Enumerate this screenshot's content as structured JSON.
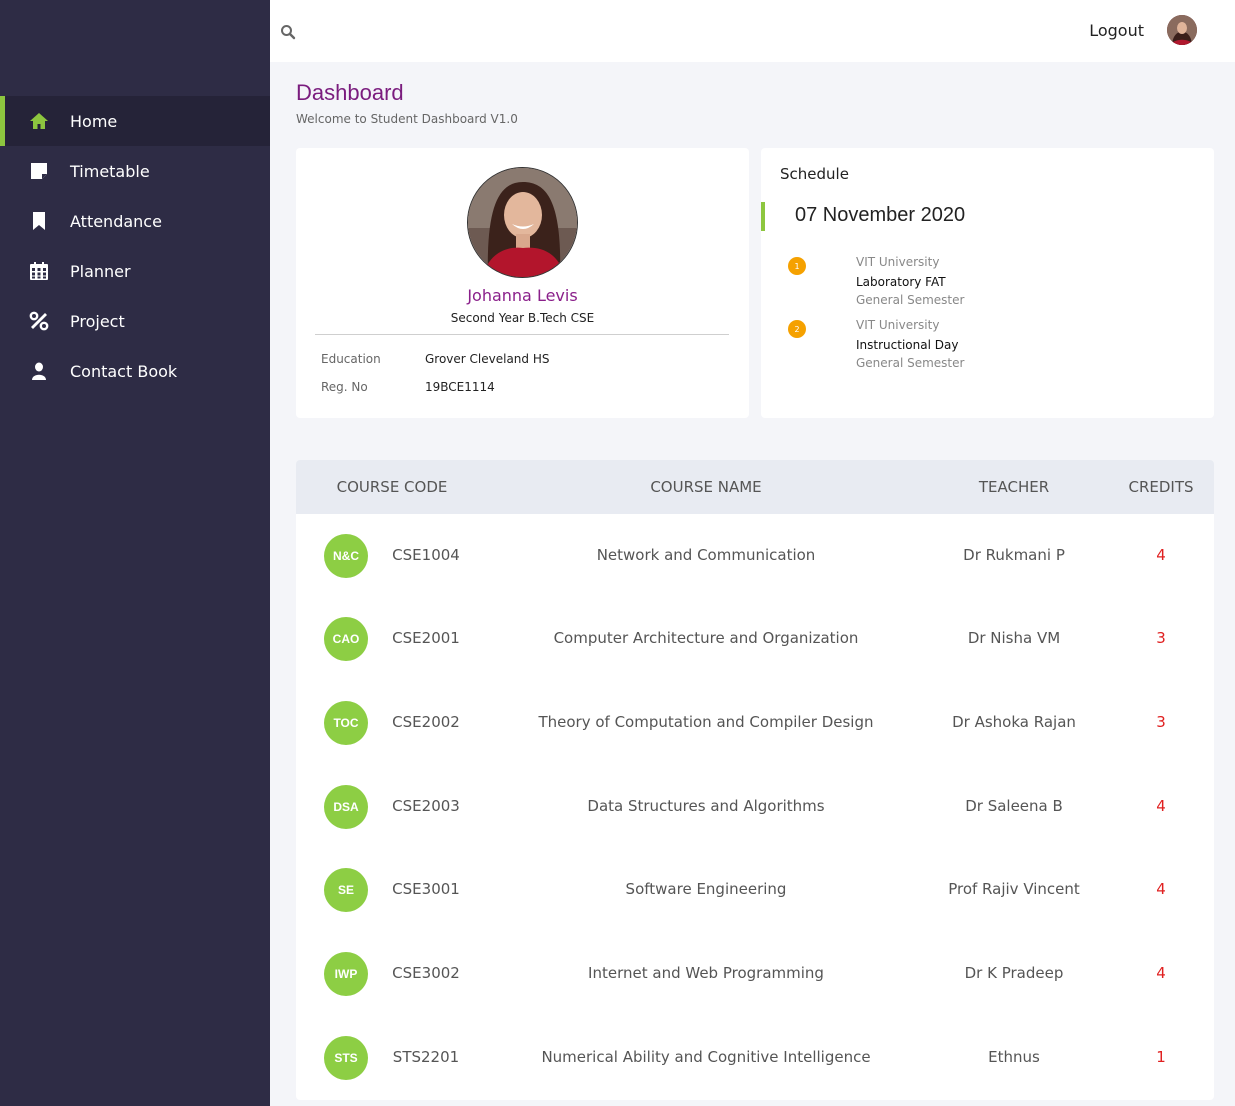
{
  "sidebar": {
    "items": [
      {
        "label": "Home",
        "icon": "home-icon",
        "active": true
      },
      {
        "label": "Timetable",
        "icon": "note-icon",
        "active": false
      },
      {
        "label": "Attendance",
        "icon": "bookmark-icon",
        "active": false
      },
      {
        "label": "Planner",
        "icon": "calendar-icon",
        "active": false
      },
      {
        "label": "Project",
        "icon": "percent-icon",
        "active": false
      },
      {
        "label": "Contact Book",
        "icon": "user-icon",
        "active": false
      }
    ],
    "accent": "#8dc63f",
    "background": "#2e2c45"
  },
  "topbar": {
    "logout_label": "Logout"
  },
  "header": {
    "title": "Dashboard",
    "subtitle": "Welcome to Student Dashboard V1.0"
  },
  "profile": {
    "name": "Johanna Levis",
    "year": "Second Year B.Tech CSE",
    "education_label": "Education",
    "education_value": "Grover Cleveland HS",
    "reg_label": "Reg. No",
    "reg_value": "19BCE1114"
  },
  "schedule": {
    "title": "Schedule",
    "date": "07 November 2020",
    "events": [
      {
        "num": "1",
        "org": "VIT University",
        "event": "Laboratory FAT",
        "term": "General Semester"
      },
      {
        "num": "2",
        "org": "VIT University",
        "event": "Instructional Day",
        "term": "General Semester"
      }
    ],
    "dot_color": "#f5a100"
  },
  "courses": {
    "headers": {
      "code": "COURSE CODE",
      "name": "COURSE NAME",
      "teacher": "TEACHER",
      "credits": "CREDITS"
    },
    "rows": [
      {
        "abbr": "N&C",
        "code": "CSE1004",
        "name": "Network and Communication",
        "teacher": "Dr Rukmani P",
        "credits": "4"
      },
      {
        "abbr": "CAO",
        "code": "CSE2001",
        "name": "Computer Architecture and Organization",
        "teacher": "Dr Nisha VM",
        "credits": "3"
      },
      {
        "abbr": "TOC",
        "code": "CSE2002",
        "name": "Theory of Computation and Compiler Design",
        "teacher": "Dr Ashoka Rajan",
        "credits": "3"
      },
      {
        "abbr": "DSA",
        "code": "CSE2003",
        "name": "Data Structures and Algorithms",
        "teacher": "Dr Saleena B",
        "credits": "4"
      },
      {
        "abbr": "SE",
        "code": "CSE3001",
        "name": "Software Engineering",
        "teacher": "Prof Rajiv Vincent",
        "credits": "4"
      },
      {
        "abbr": "IWP",
        "code": "CSE3002",
        "name": "Internet and Web Programming",
        "teacher": "Dr K Pradeep",
        "credits": "4"
      },
      {
        "abbr": "STS",
        "code": "STS2201",
        "name": "Numerical Ability and Cognitive Intelligence",
        "teacher": "Ethnus",
        "credits": "1"
      }
    ],
    "badge_color": "#8dce44",
    "credits_color": "#e02020"
  }
}
